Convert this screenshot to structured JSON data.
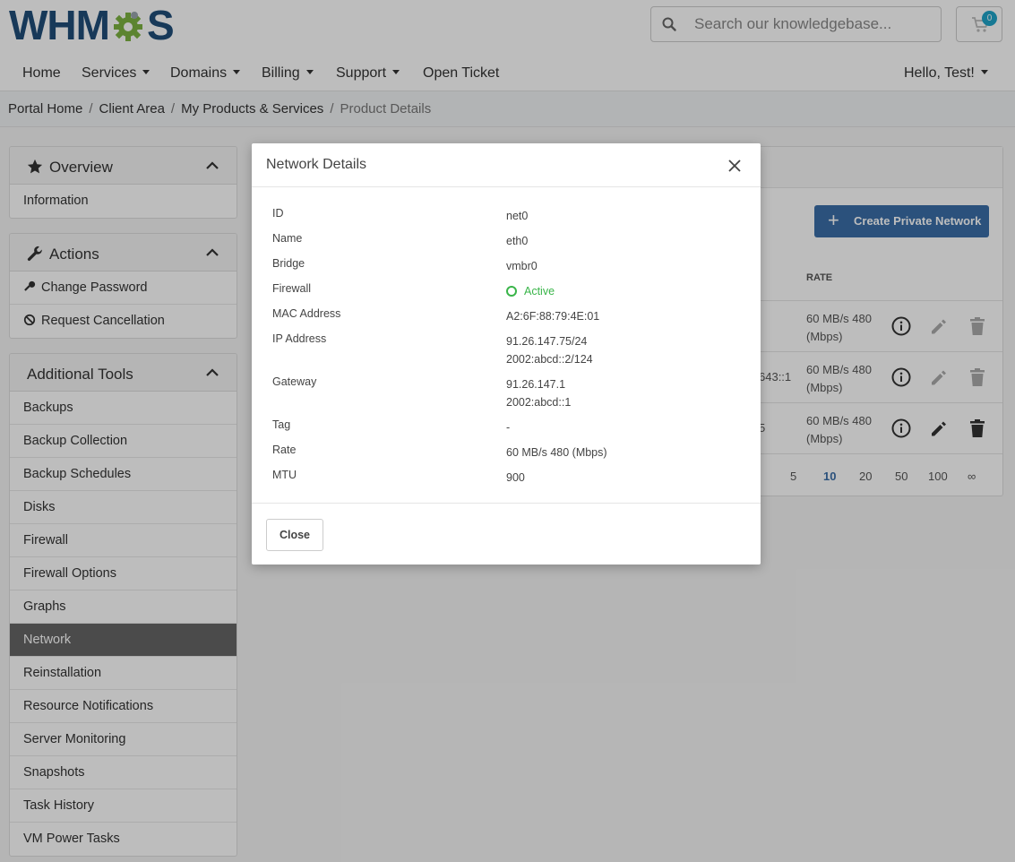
{
  "header": {
    "logo_text": "WHMCS",
    "search_placeholder": "Search our knowledgebase...",
    "cart_count": "0"
  },
  "nav": {
    "items": [
      "Home",
      "Services",
      "Domains",
      "Billing",
      "Support",
      "Open Ticket"
    ],
    "user": "Hello, Test!"
  },
  "breadcrumb": {
    "items": [
      "Portal Home",
      "Client Area",
      "My Products & Services"
    ],
    "current": "Product Details",
    "separator": "/"
  },
  "sidebar": {
    "overview": {
      "title": "Overview",
      "items": [
        "Information"
      ]
    },
    "actions": {
      "title": "Actions",
      "items": [
        "Change Password",
        "Request Cancellation"
      ]
    },
    "tools": {
      "title": "Additional Tools",
      "items": [
        "Backups",
        "Backup Collection",
        "Backup Schedules",
        "Disks",
        "Firewall",
        "Firewall Options",
        "Graphs",
        "Network",
        "Reinstallation",
        "Resource Notifications",
        "Server Monitoring",
        "Snapshots",
        "Task History",
        "VM Power Tasks"
      ],
      "active": "Network"
    }
  },
  "content": {
    "create_button": "Create Private Network",
    "rate_header": "RATE",
    "rows": [
      {
        "clip": "",
        "rate": "60 MB/s 480 (Mbps)"
      },
      {
        "clip": "643::1",
        "rate": "60 MB/s 480 (Mbps)"
      },
      {
        "clip": "5",
        "rate": "60 MB/s 480 (Mbps)"
      }
    ],
    "page_sizes": [
      "5",
      "10",
      "20",
      "50",
      "100",
      "∞"
    ],
    "page_size_active": "10"
  },
  "modal": {
    "title": "Network Details",
    "fields": [
      {
        "label": "ID",
        "value": "net0"
      },
      {
        "label": "Name",
        "value": "eth0"
      },
      {
        "label": "Bridge",
        "value": "vmbr0"
      },
      {
        "label": "Firewall",
        "value": "Active"
      },
      {
        "label": "MAC Address",
        "value": "A2:6F:88:79:4E:01"
      },
      {
        "label": "IP Address",
        "value": "91.26.147.75/24",
        "value2": "2002:abcd::2/124"
      },
      {
        "label": "Gateway",
        "value": "91.26.147.1",
        "value2": "2002:abcd::1"
      },
      {
        "label": "Tag",
        "value": "-"
      },
      {
        "label": "Rate",
        "value": "60 MB/s 480 (Mbps)"
      },
      {
        "label": "MTU",
        "value": "900"
      }
    ],
    "close_label": "Close"
  },
  "colors": {
    "brand_blue": "#1f4e79",
    "accent_blue": "#3a6ea8",
    "active_green": "#3ab54a",
    "badge": "#20a4c8"
  }
}
